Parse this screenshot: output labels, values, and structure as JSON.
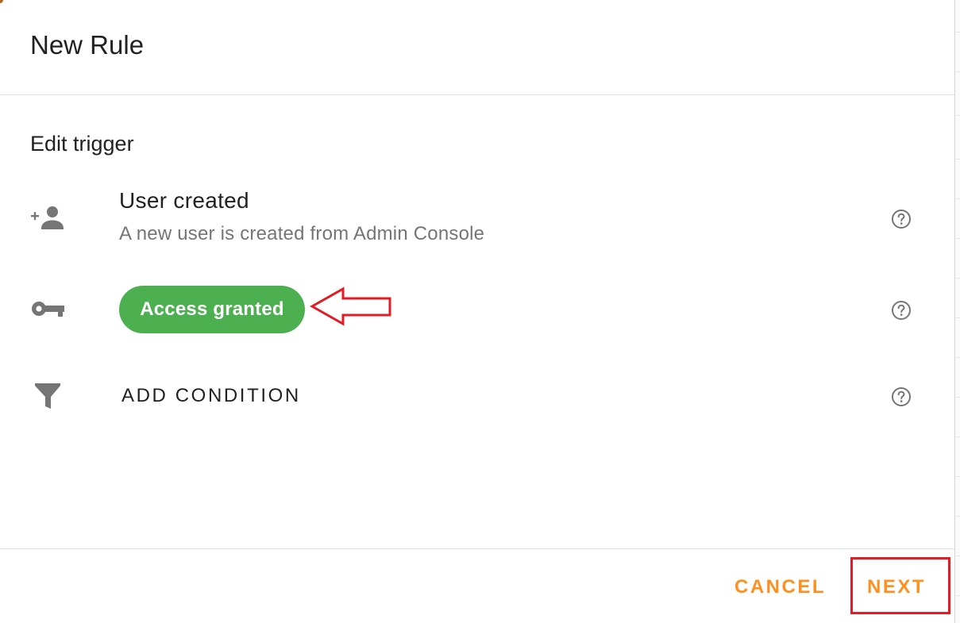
{
  "dialog": {
    "title": "New Rule"
  },
  "trigger": {
    "section_title": "Edit trigger",
    "rows": [
      {
        "icon": "person-add-icon",
        "title": "User created",
        "subtitle": "A new user is created from Admin Console",
        "help_icon": "help-circle-icon"
      },
      {
        "icon": "key-icon",
        "chip_label": "Access granted",
        "help_icon": "help-circle-icon"
      },
      {
        "icon": "filter-icon",
        "action_label": "ADD CONDITION",
        "help_icon": "help-circle-icon"
      }
    ]
  },
  "footer": {
    "cancel_label": "CANCEL",
    "next_label": "NEXT"
  },
  "colors": {
    "accent": "#ff8f1f",
    "chip": "#4caf50",
    "icon": "#757575",
    "annotation": "#e21b24"
  }
}
